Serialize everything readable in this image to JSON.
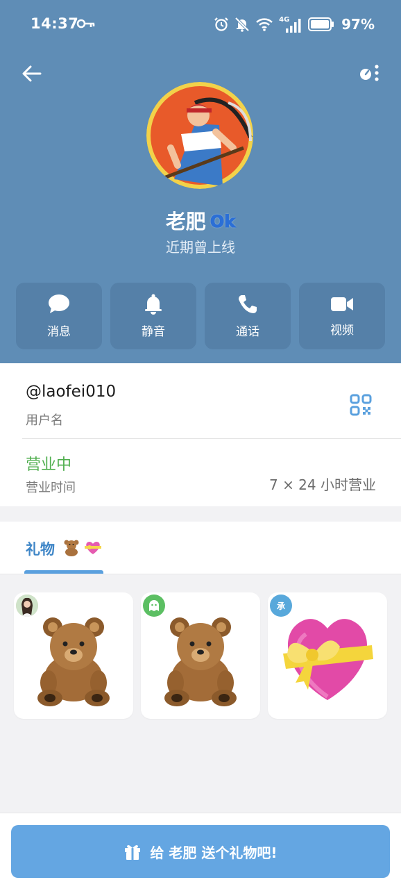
{
  "status_bar": {
    "time": "14:37",
    "battery_pct": "97%",
    "network_label": "4G"
  },
  "header": {
    "name": "老肥",
    "badge": "Ok",
    "last_seen": "近期曾上线"
  },
  "actions": [
    {
      "label": "消息",
      "icon": "chat-bubble-icon"
    },
    {
      "label": "静音",
      "icon": "bell-icon"
    },
    {
      "label": "通话",
      "icon": "phone-icon"
    },
    {
      "label": "视频",
      "icon": "video-camera-icon"
    }
  ],
  "info": {
    "username": "@laofei010",
    "username_label": "用户名",
    "open_status": "营业中",
    "hours_label": "营业时间",
    "hours_value": "7 × 24 小时营业"
  },
  "gifts": {
    "tab_label": "礼物",
    "items": [
      {
        "sender": "photo-avatar",
        "gift": "teddy-bear"
      },
      {
        "sender": "ghost-avatar",
        "gift": "teddy-bear"
      },
      {
        "sender_text": "承",
        "gift": "heart-with-ribbon"
      }
    ]
  },
  "bottom": {
    "send_label": "给 老肥 送个礼物吧!"
  },
  "colors": {
    "header_bg": "#5f8db6",
    "action_bg": "#5580a8",
    "accent": "#3f86c7",
    "open_green": "#4fae4e",
    "send_button": "#64a6e2"
  }
}
